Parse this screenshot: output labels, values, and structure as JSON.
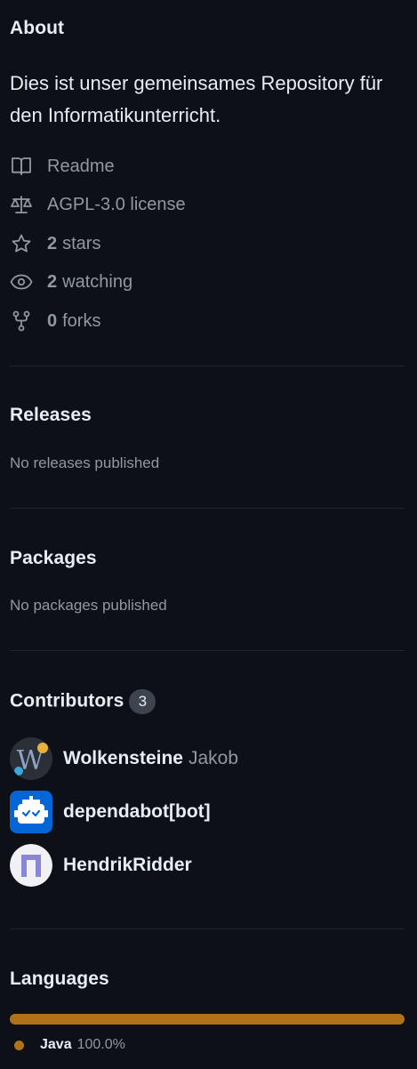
{
  "about": {
    "heading": "About",
    "description": "Dies ist unser gemeinsames Repository für den Informatikunterricht.",
    "readme": "Readme",
    "license": "AGPL-3.0 license",
    "stars_count": "2",
    "stars_label": "stars",
    "watching_count": "2",
    "watching_label": "watching",
    "forks_count": "0",
    "forks_label": "forks"
  },
  "releases": {
    "heading": "Releases",
    "empty": "No releases published"
  },
  "packages": {
    "heading": "Packages",
    "empty": "No packages published"
  },
  "contributors": {
    "heading": "Contributors",
    "count": "3",
    "items": [
      {
        "login": "Wolkensteine",
        "fullname": "Jakob"
      },
      {
        "login": "dependabot[bot]"
      },
      {
        "login": "HendrikRidder"
      }
    ]
  },
  "languages": {
    "heading": "Languages",
    "items": [
      {
        "name": "Java",
        "percent": "100.0%",
        "color": "#b07219"
      }
    ]
  },
  "icons": [
    "book-icon",
    "law-icon",
    "star-icon",
    "eye-icon",
    "repo-forked-icon"
  ]
}
